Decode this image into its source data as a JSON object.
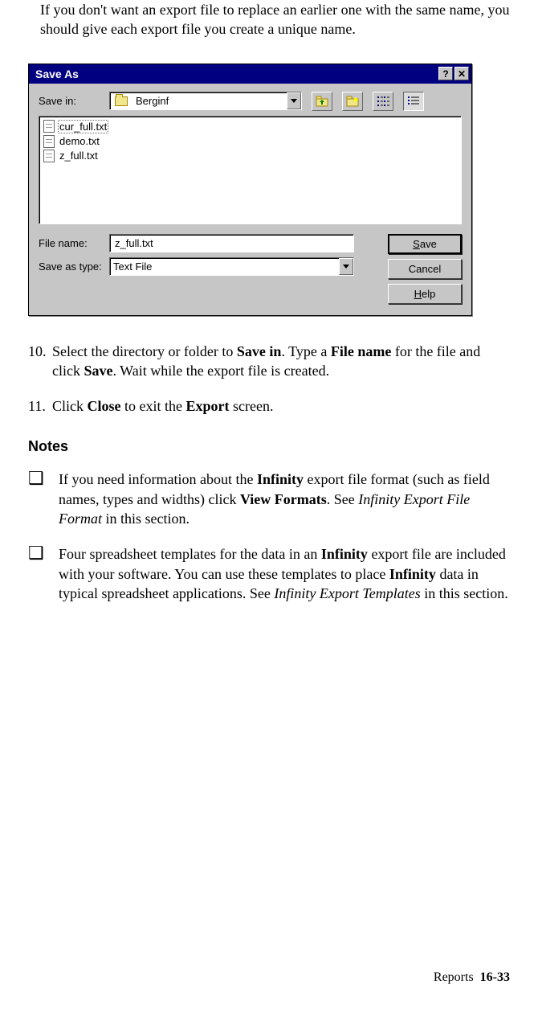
{
  "intro": "If you don't want an export file to replace an earlier one with the same name, you should give each export file you create a unique name.",
  "dialog": {
    "title": "Save As",
    "help_btn": "?",
    "close_btn": "✕",
    "save_in_label": "Save in:",
    "save_in_value": "Berginf",
    "files": [
      "cur_full.txt",
      "demo.txt",
      "z_full.txt"
    ],
    "filename_label": "File name:",
    "filename_value": "z_full.txt",
    "saveastype_label": "Save as type:",
    "saveastype_value": "Text File",
    "save_btn_u": "S",
    "save_btn_rest": "ave",
    "cancel_btn": "Cancel",
    "help_btn_u": "H",
    "help_btn_rest": "elp"
  },
  "step10": {
    "num": "10.",
    "p1a": "Select the directory or folder to ",
    "p1b": "Save in",
    "p1c": ". Type a ",
    "p1d": "File name",
    "p1e": " for the file and click ",
    "p1f": "Save",
    "p1g": ". Wait while the export file is created."
  },
  "step11": {
    "num": "11.",
    "p1a": "Click ",
    "p1b": "Close",
    "p1c": " to exit the ",
    "p1d": "Export",
    "p1e": " screen."
  },
  "notes_heading": "Notes",
  "note1": {
    "a": "If you need information about the ",
    "b": "Infinity",
    "c": " export file format (such as field names, types and widths) click ",
    "d": "View Formats",
    "e": ". See ",
    "f": "Infinity Export File Format",
    "g": " in this section."
  },
  "note2": {
    "a": "Four spreadsheet templates for the data in an ",
    "b": "Infinity",
    "c": " export file are included with your software. You can use these templates to place ",
    "d": "Infinity",
    "e": " data in typical spreadsheet applications. See ",
    "f": "Infinity Export Templates",
    "g": " in this section."
  },
  "footer": {
    "section": "Reports",
    "page": "16-33"
  }
}
